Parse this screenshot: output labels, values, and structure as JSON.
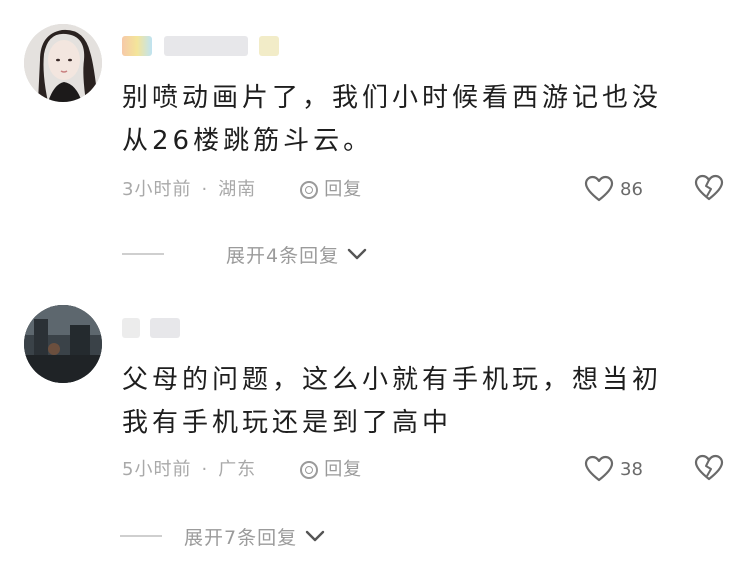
{
  "comments": [
    {
      "username": "",
      "text_line1": "别喷动画片了，我们小时候看西游记也没",
      "text_line2": "从26楼跳筋斗云。",
      "time": "3小时前",
      "location": "湖南",
      "separator": "·",
      "reply_label": "回复",
      "likes": "86",
      "expand_label": "展开4条回复"
    },
    {
      "username": "",
      "text_line1": "父母的问题，这么小就有手机玩，想当初",
      "text_line2": "我有手机玩还是到了高中",
      "time": "5小时前",
      "location": "广东",
      "separator": "·",
      "reply_label": "回复",
      "likes": "38",
      "expand_label": "展开7条回复"
    }
  ],
  "icons": {
    "like": "heart-outline-icon",
    "dislike": "broken-heart-icon",
    "reply": "reply-icon",
    "expand": "chevron-down-icon"
  },
  "colors": {
    "text": "#1e1e1e",
    "meta": "#a9a9a9",
    "icon": "#6a6a6a"
  }
}
